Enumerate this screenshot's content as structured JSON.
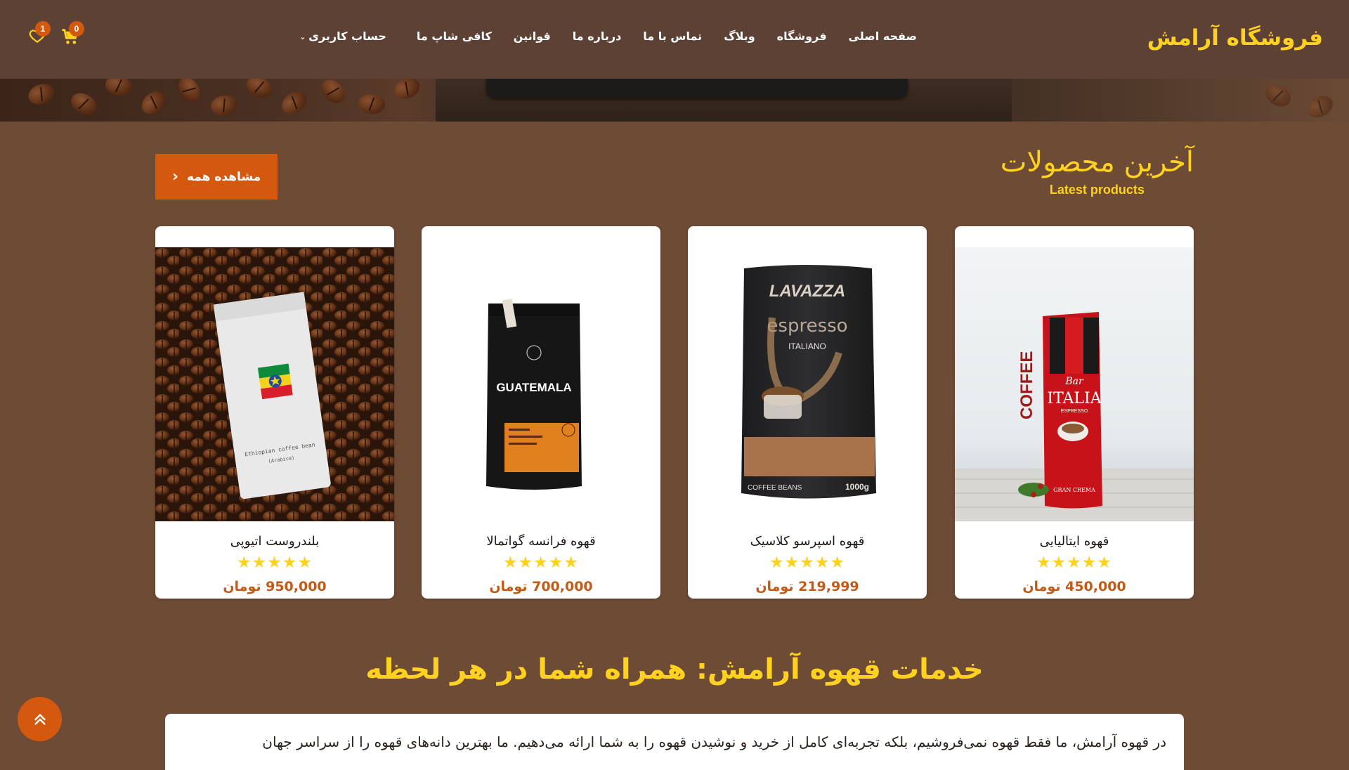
{
  "header": {
    "logo": "فروشگاه آرامش",
    "nav": [
      "صفحه اصلی",
      "فروشگاه",
      "وبلاگ",
      "تماس با ما",
      "درباره ما",
      "قوانین",
      "کافی شاپ ما"
    ],
    "account_label": "حساب کاربری",
    "cart_count": "0",
    "wishlist_count": "1"
  },
  "latest": {
    "title": "آخرین محصولات",
    "subtitle": "Latest products",
    "view_all": "مشاهده همه"
  },
  "products": [
    {
      "name": "قهوه ایتالیایی",
      "price": "450,000 تومان",
      "rating": 5
    },
    {
      "name": "قهوه اسپرسو کلاسیک",
      "price": "219,999 تومان",
      "rating": 5
    },
    {
      "name": "قهوه فرانسه گواتمالا",
      "price": "700,000 تومان",
      "rating": 5
    },
    {
      "name": "بلندروست اتیوپی",
      "price": "950,000 تومان",
      "rating": 5
    }
  ],
  "product_packaging": {
    "italia": {
      "side": "COFFEE",
      "brand_top": "Bar",
      "brand": "ITALIA",
      "line": "ESPRESSO",
      "foot": "GRAN CREMA"
    },
    "lavazza": {
      "brand": "LAVAZZA",
      "line": "espresso",
      "sub": "ITALIANO",
      "foot_left": "COFFEE BEANS",
      "foot_right": "1000g"
    },
    "guatemala": {
      "brand": "GUATEMALA"
    },
    "ethiopia": {
      "label": "Ethiopian coffee bean",
      "sub": "(Arabica)"
    }
  },
  "services": {
    "title": "خدمات قهوه آرامش: همراه شما در هر لحظه",
    "text": "در قهوه آرامش، ما فقط قهوه نمی‌فروشیم، بلکه تجربه‌ای کامل از خرید و نوشیدن قهوه را به شما ارائه می‌دهیم. ما بهترین دانه‌های قهوه را از سراسر جهان"
  },
  "colors": {
    "header_bg": "#5d4134",
    "page_bg": "#6e4b35",
    "accent": "#d4590f",
    "highlight": "#ffd21f"
  },
  "icons": [
    "heart-icon",
    "cart-icon",
    "chevron-left-icon",
    "chevron-down-icon",
    "double-chevron-up-icon",
    "star-icon"
  ]
}
